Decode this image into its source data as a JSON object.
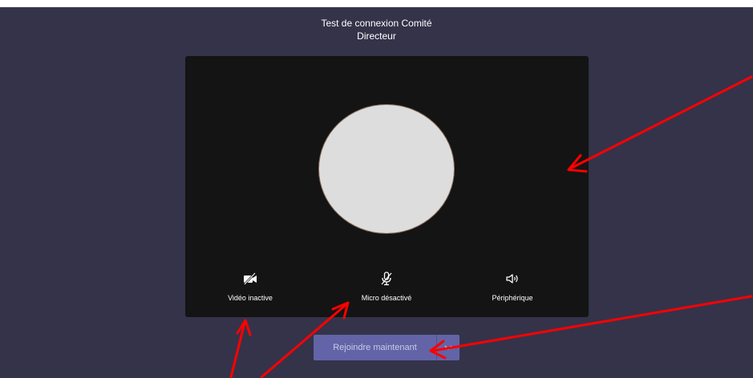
{
  "meeting": {
    "title_line1": "Test de connexion Comité",
    "title_line2": "Directeur"
  },
  "controls": {
    "video_label": "Vidéo inactive",
    "mic_label": "Micro désactivé",
    "device_label": "Périphérique"
  },
  "join": {
    "label": "Rejoindre maintenant"
  },
  "icons": {
    "video": "video-off-icon",
    "mic": "mic-off-icon",
    "device": "speaker-icon",
    "chevron": "chevron-down-icon"
  },
  "colors": {
    "background": "#34334a",
    "preview": "#141414",
    "avatar": "#dddddd",
    "join_button": "#6264a7",
    "annotation_arrows": "#ff0000"
  }
}
